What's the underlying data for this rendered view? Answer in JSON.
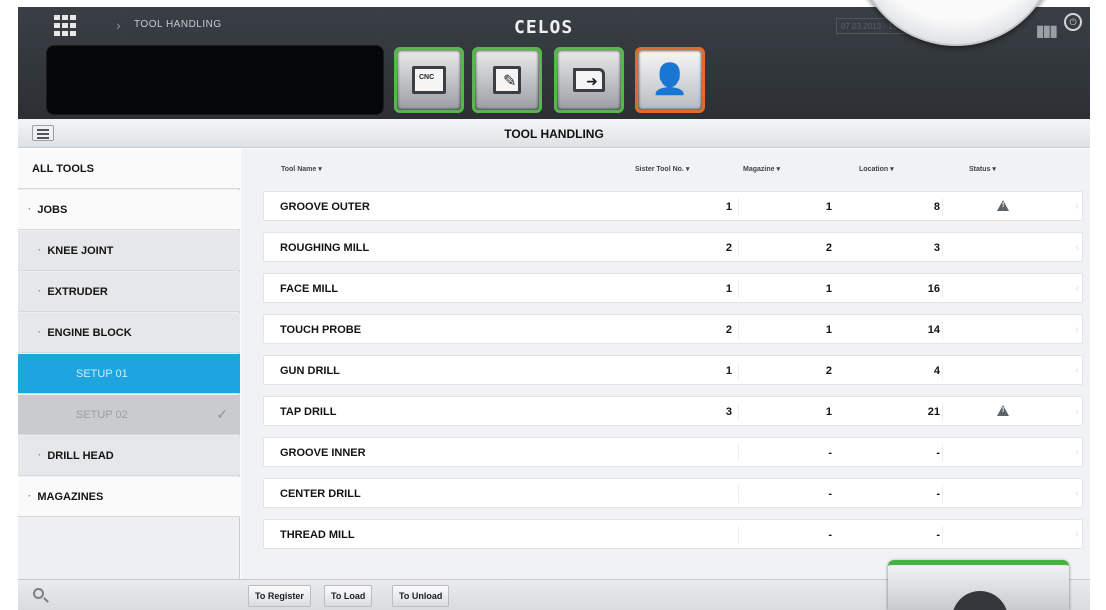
{
  "header": {
    "breadcrumb": "TOOL HANDLING",
    "brand": "CELOS",
    "datetime": "07.03.2013 · 13:41"
  },
  "app_tiles": [
    {
      "name": "CNC",
      "active": false
    },
    {
      "name": "documents",
      "active": false
    },
    {
      "name": "transfer",
      "active": false
    },
    {
      "name": "tool-handling",
      "active": true
    }
  ],
  "titlebar": {
    "title": "TOOL HANDLING"
  },
  "sidebar": {
    "items": [
      {
        "label": "ALL TOOLS"
      },
      {
        "label": "JOBS"
      },
      {
        "label": "KNEE JOINT"
      },
      {
        "label": "EXTRUDER"
      },
      {
        "label": "ENGINE BLOCK"
      },
      {
        "label": "SETUP 01"
      },
      {
        "label": "SETUP 02"
      },
      {
        "label": "DRILL HEAD"
      },
      {
        "label": "MAGAZINES"
      }
    ]
  },
  "table": {
    "columns": [
      "Tool Name",
      "Sister Tool No.",
      "Magazine",
      "Location",
      "Status"
    ],
    "rows": [
      {
        "name": "GROOVE OUTER",
        "sister": "1",
        "magazine": "1",
        "location": "8",
        "status": "warning"
      },
      {
        "name": "ROUGHING MILL",
        "sister": "2",
        "magazine": "2",
        "location": "3",
        "status": ""
      },
      {
        "name": "FACE MILL",
        "sister": "1",
        "magazine": "1",
        "location": "16",
        "status": ""
      },
      {
        "name": "TOUCH PROBE",
        "sister": "2",
        "magazine": "1",
        "location": "14",
        "status": ""
      },
      {
        "name": "GUN DRILL",
        "sister": "1",
        "magazine": "2",
        "location": "4",
        "status": ""
      },
      {
        "name": "TAP DRILL",
        "sister": "3",
        "magazine": "1",
        "location": "21",
        "status": "warning"
      },
      {
        "name": "GROOVE INNER",
        "sister": "",
        "magazine": "-",
        "location": "-",
        "status": ""
      },
      {
        "name": "CENTER DRILL",
        "sister": "",
        "magazine": "-",
        "location": "-",
        "status": ""
      },
      {
        "name": "THREAD MILL",
        "sister": "",
        "magazine": "-",
        "location": "-",
        "status": ""
      }
    ]
  },
  "bottombar": {
    "register_label": "To Register",
    "load_label": "To Load",
    "unload_label": "To Unload"
  },
  "colors": {
    "accent_green": "#55b949",
    "accent_orange": "#e46a2c",
    "selection_blue": "#1ea4df"
  }
}
